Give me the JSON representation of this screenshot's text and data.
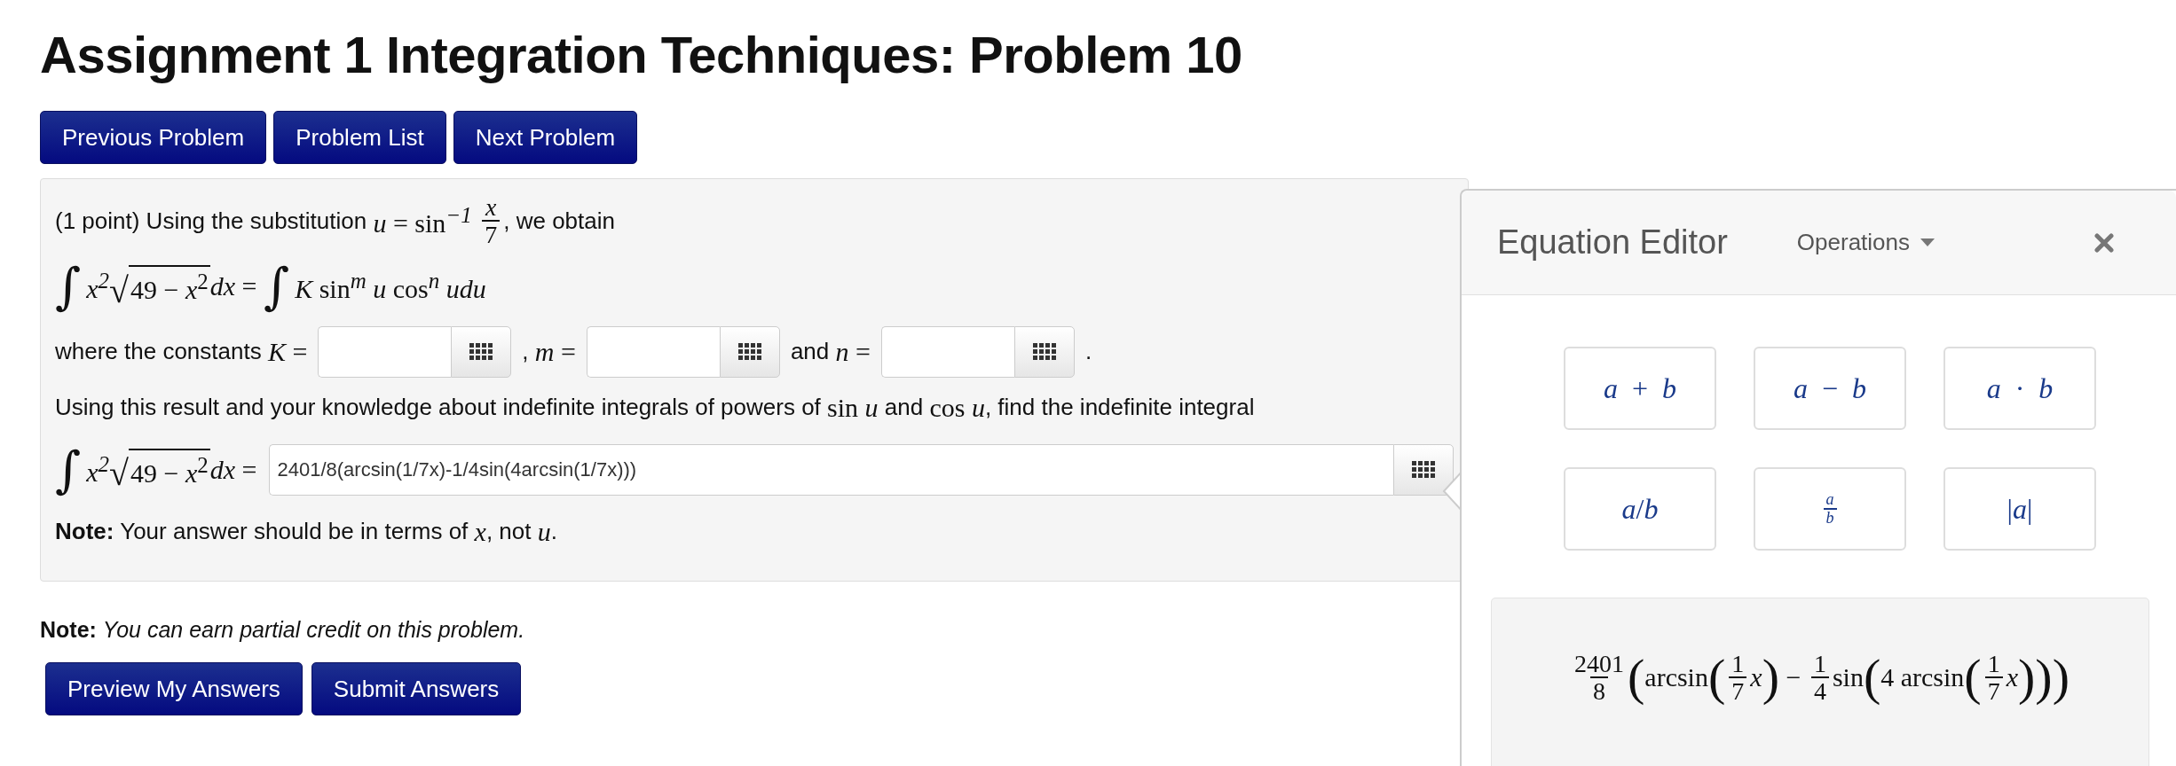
{
  "title": "Assignment 1 Integration Techniques: Problem 10",
  "nav_buttons": [
    "Previous Problem",
    "Problem List",
    "Next Problem"
  ],
  "problem": {
    "lines": [
      {
        "items": [
          {
            "kind": "text",
            "segments": [
              {
                "kind": "text",
                "text": "(1 point) Using the substitution "
              },
              {
                "kind": "math",
                "text": "*u* = sin$^{−1}$ "
              },
              {
                "kind": "frac",
                "num": "*x*",
                "den": "7"
              },
              {
                "kind": "text",
                "text": ", we obtain"
              }
            ]
          }
        ]
      },
      {
        "items": [
          {
            "kind": "formula",
            "segments": [
              {
                "kind": "int",
                "text": "∫"
              },
              {
                "kind": "math",
                "text": "*x*$^{2}$"
              },
              {
                "kind": "sqrt",
                "radical": "√",
                "text": "49 − *x*$^{2}$"
              },
              {
                "kind": "math",
                "text": "*dx* = "
              },
              {
                "kind": "int",
                "text": "∫"
              },
              {
                "kind": "math",
                "text": "*K* sin$^{m}$ *u* cos$^{n}$ *udu*"
              }
            ]
          }
        ]
      },
      {
        "items": [
          {
            "kind": "text",
            "segments": [
              {
                "kind": "text",
                "text": "where the constants "
              },
              {
                "kind": "math",
                "text": "*K* ="
              }
            ]
          },
          {
            "kind": "input"
          },
          {
            "kind": "text",
            "segments": [
              {
                "kind": "text",
                "text": ", "
              },
              {
                "kind": "math",
                "text": "*m* ="
              }
            ]
          },
          {
            "kind": "input"
          },
          {
            "kind": "text",
            "segments": [
              {
                "kind": "text",
                "text": "and "
              },
              {
                "kind": "math",
                "text": "*n* ="
              }
            ]
          },
          {
            "kind": "input"
          },
          {
            "kind": "text",
            "segments": [
              {
                "kind": "text",
                "text": "."
              }
            ]
          }
        ]
      },
      {
        "items": [
          {
            "kind": "text",
            "segments": [
              {
                "kind": "text",
                "text": "Using this result and your knowledge about indefinite integrals of powers of "
              },
              {
                "kind": "math",
                "text": "sin *u*"
              },
              {
                "kind": "text",
                "text": " and "
              },
              {
                "kind": "math",
                "text": "cos *u*"
              },
              {
                "kind": "text",
                "text": ", find the indefinite integral"
              }
            ]
          }
        ]
      },
      {
        "items": [
          {
            "kind": "formula",
            "segments": [
              {
                "kind": "int",
                "text": "∫"
              },
              {
                "kind": "math",
                "text": "*x*$^{2}$"
              },
              {
                "kind": "sqrt",
                "radical": "√",
                "text": "49 − *x*$^{2}$"
              },
              {
                "kind": "math",
                "text": "*dx* ="
              }
            ]
          },
          {
            "kind": "answer",
            "value": "2401/8(arcsin(1/7x)-1/4sin(4arcsin(1/7x)))"
          }
        ]
      },
      {
        "items": [
          {
            "kind": "text",
            "segments": [
              {
                "kind": "text",
                "text": "**Note:** Your answer should be in terms of "
              },
              {
                "kind": "math",
                "text": "*x*"
              },
              {
                "kind": "text",
                "text": ", not "
              },
              {
                "kind": "math",
                "text": "*u*"
              },
              {
                "kind": "text",
                "text": "."
              }
            ]
          }
        ]
      }
    ]
  },
  "note": "**Note:** *You can earn partial credit on this problem.*",
  "action_buttons": [
    "Preview My Answers",
    "Submit Answers"
  ],
  "equation_editor": {
    "title": "Equation Editor",
    "menu": "Operations",
    "buttons": [
      {
        "kind": "math",
        "label": "*a* + *b*"
      },
      {
        "kind": "math",
        "label": "*a* − *b*"
      },
      {
        "kind": "math",
        "label": "*a* · *b*"
      },
      {
        "kind": "math",
        "label": "*a*/*b*"
      },
      {
        "kind": "frac",
        "num": "*a*",
        "den": "*b*"
      },
      {
        "kind": "math",
        "label": "|*a*|"
      }
    ],
    "preview": [
      {
        "kind": "frac",
        "num": "2401",
        "den": "8"
      },
      {
        "kind": "paren",
        "text": "("
      },
      {
        "kind": "math",
        "text": "arcsin"
      },
      {
        "kind": "paren",
        "text": "("
      },
      {
        "kind": "frac",
        "num": "1",
        "den": "7"
      },
      {
        "kind": "math",
        "text": "*x*"
      },
      {
        "kind": "paren",
        "text": ")"
      },
      {
        "kind": "math",
        "text": " − "
      },
      {
        "kind": "frac",
        "num": "1",
        "den": "4"
      },
      {
        "kind": "math",
        "text": "sin"
      },
      {
        "kind": "paren",
        "text": "("
      },
      {
        "kind": "math",
        "text": "4 arcsin"
      },
      {
        "kind": "paren",
        "text": "("
      },
      {
        "kind": "frac",
        "num": "1",
        "den": "7"
      },
      {
        "kind": "math",
        "text": "*x*"
      },
      {
        "kind": "paren",
        "text": ")"
      },
      {
        "kind": "paren",
        "text": ")"
      },
      {
        "kind": "paren",
        "text": ")"
      }
    ]
  }
}
